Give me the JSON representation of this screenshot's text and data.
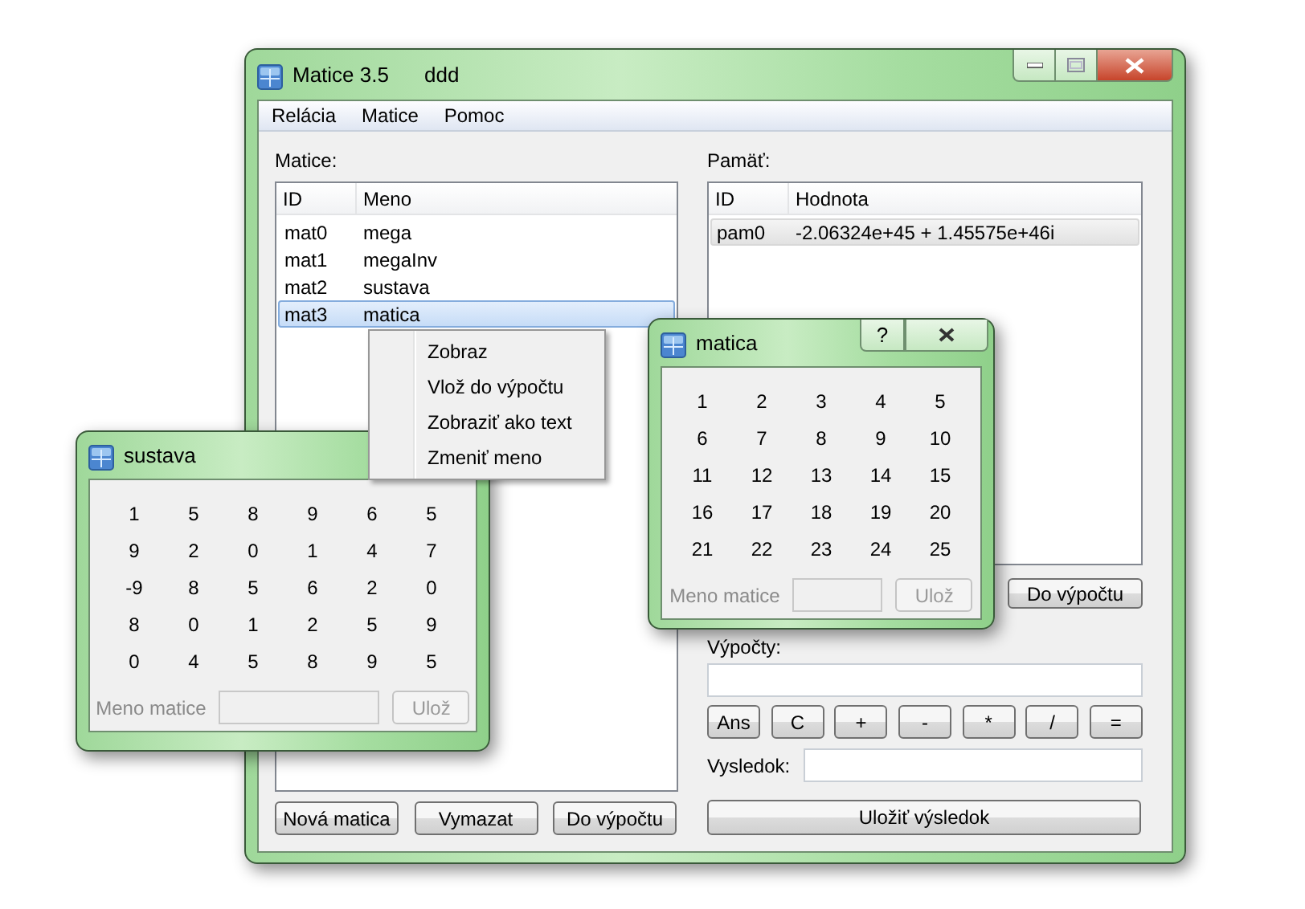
{
  "main_window": {
    "title": "Matice 3.5",
    "subtitle": "ddd",
    "menu": [
      "Relácia",
      "Matice",
      "Pomoc"
    ],
    "matrices_label": "Matice:",
    "matrices_table": {
      "focused": true,
      "columns": [
        "ID",
        "Meno"
      ],
      "rows": [
        {
          "cells": [
            "mat0",
            "mega"
          ],
          "selected": false
        },
        {
          "cells": [
            "mat1",
            "megaInv"
          ],
          "selected": false
        },
        {
          "cells": [
            "mat2",
            "sustava"
          ],
          "selected": false
        },
        {
          "cells": [
            "mat3",
            "matica"
          ],
          "selected": true
        }
      ]
    },
    "matrices_buttons": [
      "Nová matica",
      "Vymazat",
      "Do výpočtu"
    ],
    "memory_label": "Pamäť:",
    "memory_table": {
      "focused": false,
      "columns": [
        "ID",
        "Hodnota"
      ],
      "rows": [
        {
          "cells": [
            "pam0",
            "-2.06324e+45 + 1.45575e+46i"
          ],
          "selected": true
        }
      ]
    },
    "memory_button": "Do výpočtu",
    "calc_label": "Výpočty:",
    "calc_keys": [
      "Ans",
      "C",
      "+",
      "-",
      "*",
      "/",
      "="
    ],
    "result_label": "Vysledok:",
    "save_button": "Uložiť výsledok"
  },
  "context_menu": {
    "items": [
      "Zobraz",
      "Vlož do výpočtu",
      "Zobraziť ako text",
      "Zmeniť meno"
    ]
  },
  "dialogs": [
    {
      "title": "matica",
      "help": "?",
      "close": true,
      "rows": [
        [
          "1",
          "2",
          "3",
          "4",
          "5"
        ],
        [
          "6",
          "7",
          "8",
          "9",
          "10"
        ],
        [
          "11",
          "12",
          "13",
          "14",
          "15"
        ],
        [
          "16",
          "17",
          "18",
          "19",
          "20"
        ],
        [
          "21",
          "22",
          "23",
          "24",
          "25"
        ]
      ],
      "name_label": "Meno matice",
      "save_label": "Ulož",
      "disabled": true
    },
    {
      "title": "sustava",
      "rows": [
        [
          "1",
          "5",
          "8",
          "9",
          "6",
          "5"
        ],
        [
          "9",
          "2",
          "0",
          "1",
          "4",
          "7"
        ],
        [
          "-9",
          "8",
          "5",
          "6",
          "2",
          "0"
        ],
        [
          "8",
          "0",
          "1",
          "2",
          "5",
          "9"
        ],
        [
          "0",
          "4",
          "5",
          "8",
          "9",
          "5"
        ]
      ],
      "name_label": "Meno matice",
      "save_label": "Ulož",
      "disabled": true
    }
  ]
}
